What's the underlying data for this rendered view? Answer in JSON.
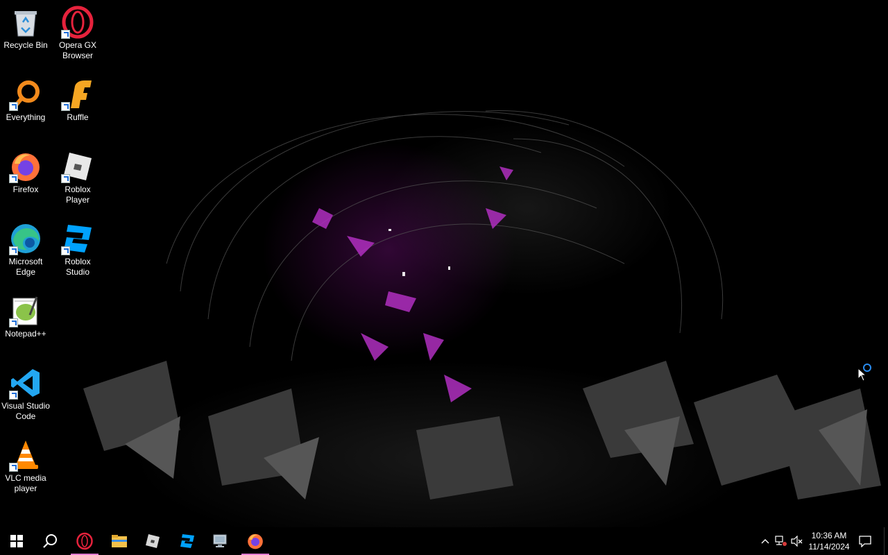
{
  "desktop": {
    "icons": [
      {
        "label": "Recycle Bin",
        "icon": "recycle-bin-icon"
      },
      {
        "label": "Opera GX Browser",
        "icon": "opera-gx-icon"
      },
      {
        "label": "Everything",
        "icon": "everything-search-icon"
      },
      {
        "label": "Ruffle",
        "icon": "ruffle-icon"
      },
      {
        "label": "Firefox",
        "icon": "firefox-icon"
      },
      {
        "label": "Roblox Player",
        "icon": "roblox-player-icon"
      },
      {
        "label": "Microsoft Edge",
        "icon": "edge-icon"
      },
      {
        "label": "Roblox Studio",
        "icon": "roblox-studio-icon"
      },
      {
        "label": "Notepad++",
        "icon": "notepadpp-icon"
      },
      {
        "label": "Visual Studio Code",
        "icon": "vscode-icon"
      },
      {
        "label": "VLC media player",
        "icon": "vlc-icon"
      }
    ]
  },
  "taskbar": {
    "start": "windows-start-icon",
    "search": "search-icon",
    "pinned": [
      "opera-gx-icon",
      "file-explorer-icon",
      "roblox-player-icon",
      "roblox-studio-icon",
      "computer-icon",
      "firefox-icon"
    ],
    "tray": {
      "icons": [
        "chevron-up-icon",
        "network-disconnected-icon",
        "volume-muted-icon"
      ],
      "time": "10:36 AM",
      "date": "11/14/2024",
      "notification": "action-center-icon"
    }
  },
  "colors": {
    "accent": "#e07ad0",
    "wallpaper_magenta": "#c23bd4",
    "busy_ring": "#2a8cf0"
  }
}
